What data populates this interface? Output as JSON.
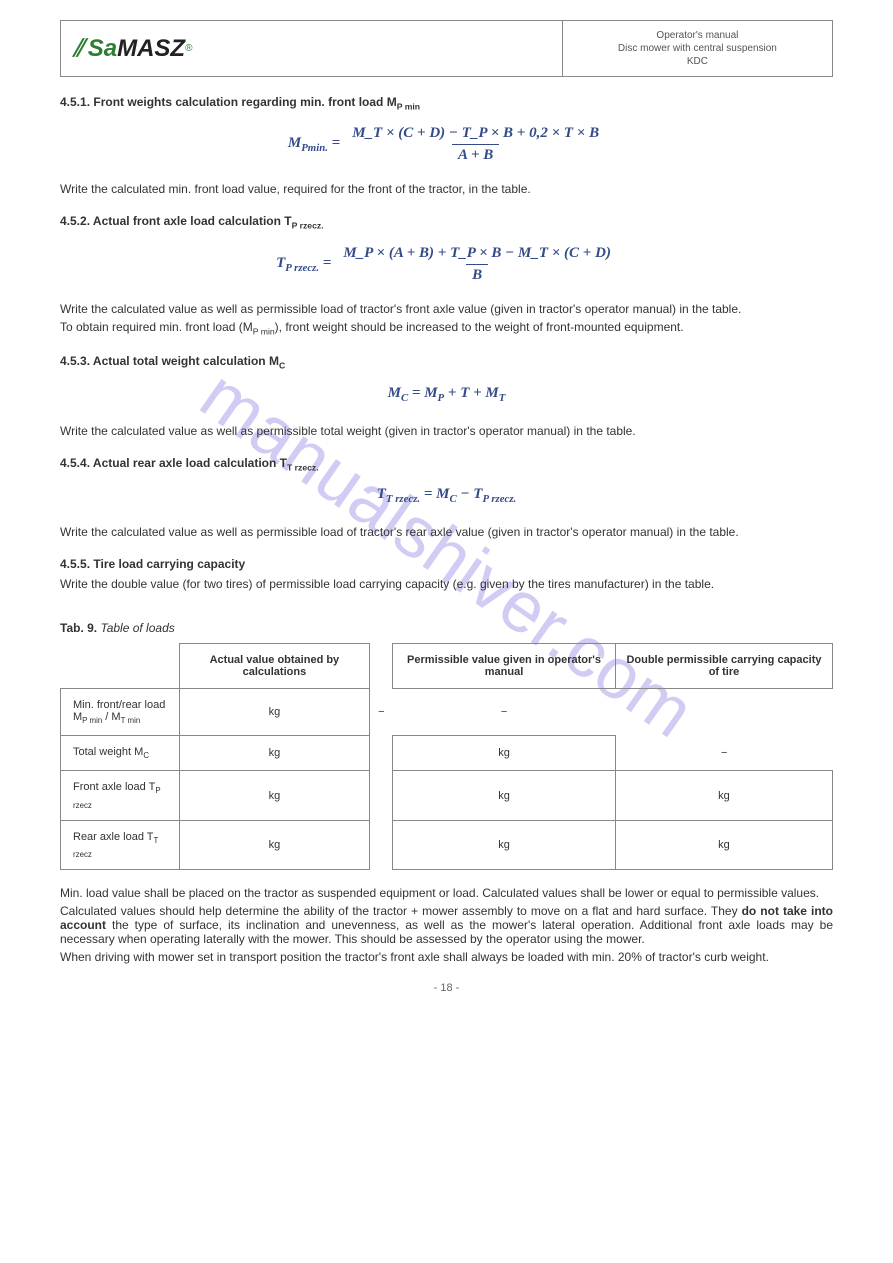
{
  "watermark": "manualshiver.com",
  "header": {
    "logo_prefix_icon": "⫽",
    "logo_sa": "Sa",
    "logo_masz": "MASZ",
    "logo_r": "®",
    "title_line1": "Operator's manual",
    "title_line2": "Disc mower with central suspension",
    "title_line3": "KDC"
  },
  "s1": {
    "num": "4.5.1.",
    "title": "Front weights calculation regarding min. front load M",
    "title_sub": "P min",
    "f_lhs": "M_{Pmin.} =",
    "f_num": "M_T × (C + D) −  T_P × B + 0,2 × T × B",
    "f_den": "A + B",
    "note": "Write the calculated min. front load value, required for the front of the tractor, in the table."
  },
  "s2": {
    "num": "4.5.2.",
    "title": "Actual front axle load calculation T",
    "title_sub": "P rzecz.",
    "f_lhs": "T_{P rzecz.} =",
    "f_num": "M_P × (A + B) + T_P × B − M_T × (C + D)",
    "f_den": "B",
    "note1": "Write the calculated value as well as permissible load of tractor's front axle value (given in tractor's operator manual) in the table.",
    "note2": "To obtain required min. front load (M",
    "note2_sub": "P min",
    "note2_tail": "), front weight should be increased to the weight of front-mounted equipment."
  },
  "s3": {
    "num": "4.5.3.",
    "title": "Actual total weight calculation M",
    "title_sub": "C",
    "formula": "M_C = M_P + T + M_T",
    "note": "Write the calculated value as well as permissible total weight (given in tractor's operator manual) in the table."
  },
  "s4": {
    "num": "4.5.4.",
    "title": "Actual rear axle load calculation T",
    "title_sub": "T rzecz.",
    "formula": "T_{T rzecz.} = M_C − T_{P rzecz.}",
    "note": "Write the calculated value as well as permissible load of tractor's rear axle value (given in tractor's operator manual) in the table."
  },
  "s5": {
    "num": "4.5.5.",
    "title": "Tire load carrying capacity",
    "note": "Write the double value (for two tires) of permissible load carrying capacity (e.g. given by the tires manufacturer) in the table."
  },
  "tab9_label": "Tab. 9.",
  "tab9_title": "Table of loads",
  "table": {
    "h1": "Actual value obtained by calculations",
    "h2": "Permissible value given in operator's manual",
    "h3": "Double permissible carrying capacity of tire",
    "r1": {
      "label": "Min. front/rear load",
      "sym": "M_{P min} / M_{T min}",
      "unit": "kg",
      "c2": "−",
      "c3": "−"
    },
    "r2": {
      "label": "Total weight",
      "sym": "M_C",
      "unit": "kg",
      "c3": "−"
    },
    "r3": {
      "label": "Front axle load",
      "sym": "T_{P rzecz}",
      "unit": "kg"
    },
    "r4": {
      "label": "Rear axle load",
      "sym": "T_{T rzecz}",
      "unit": "kg"
    }
  },
  "tail": {
    "p1": "Min. load value shall be placed on the tractor as suspended equipment or load. Calculated values shall be lower or equal to permissible values.",
    "p2_a": "Calculated values should help determine the ability of the tractor + mower assembly to move on a flat and hard surface. They",
    "p2_b": " do not take into account ",
    "p2_c": "the type of surface, its inclination and unevenness, as well as the mower's lateral operation. Additional front axle loads may be necessary when operating laterally with the mower. This should be assessed by the operator using the mower.",
    "p3": "When driving with mower set in transport position the tractor's front axle shall always be loaded with min. 20% of tractor's curb weight."
  },
  "footer": "- 18 -"
}
